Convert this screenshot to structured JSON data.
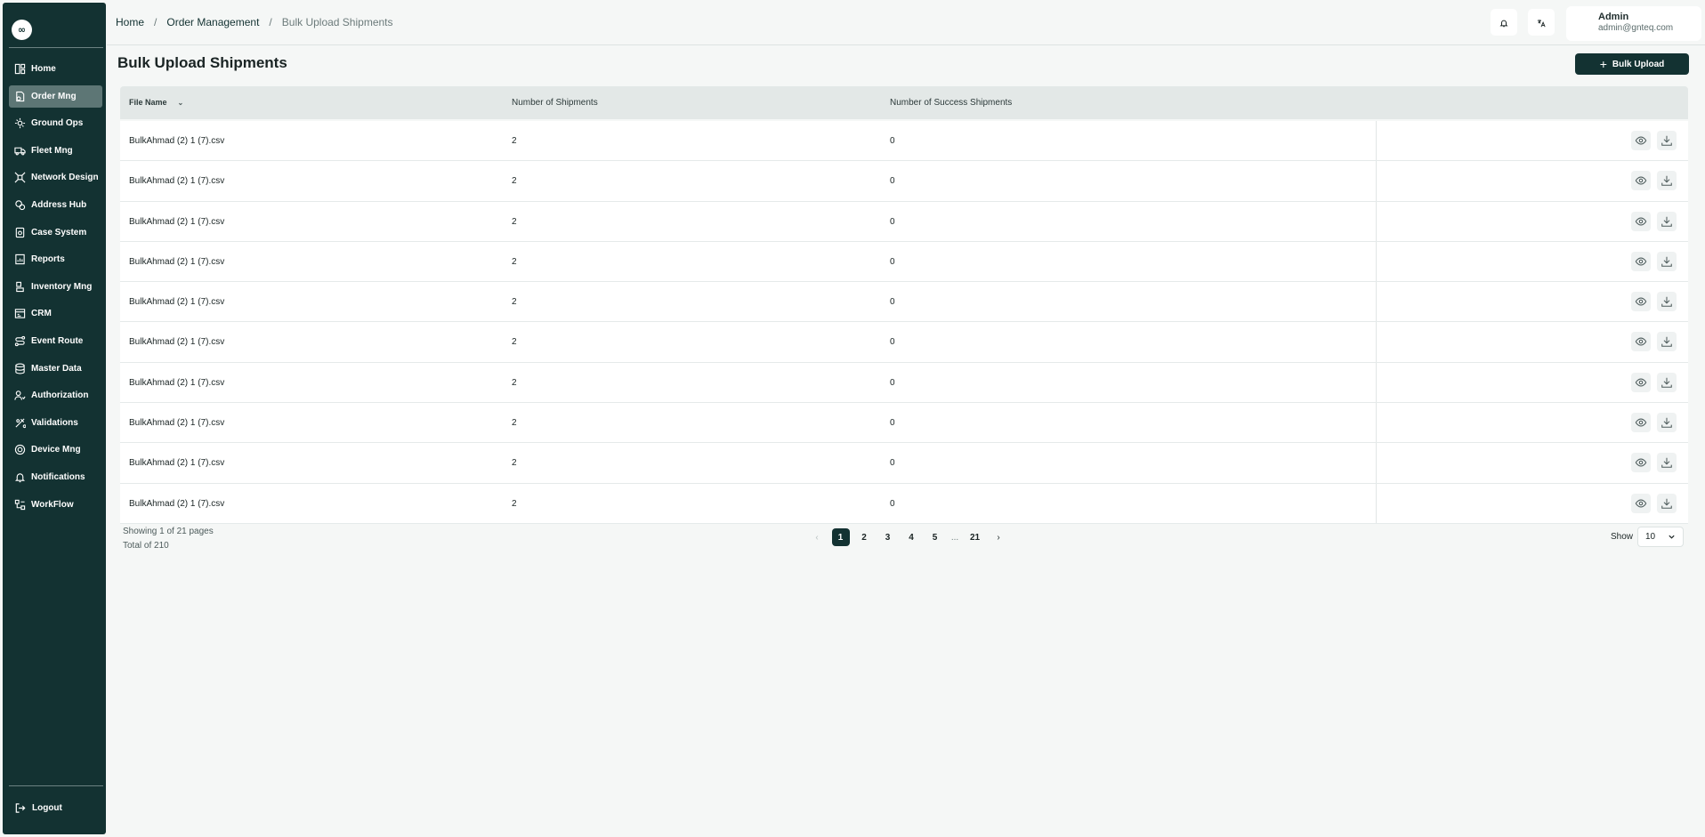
{
  "app": {
    "logo_text": "∞"
  },
  "sidebar": {
    "items": [
      {
        "label": "Home",
        "icon": "home-icon",
        "active": false
      },
      {
        "label": "Order Mng",
        "icon": "order-icon",
        "active": true
      },
      {
        "label": "Ground Ops",
        "icon": "ground-ops-icon",
        "active": false
      },
      {
        "label": "Fleet Mng",
        "icon": "truck-icon",
        "active": false
      },
      {
        "label": "Network Design",
        "icon": "network-icon",
        "active": false
      },
      {
        "label": "Address Hub",
        "icon": "address-icon",
        "active": false
      },
      {
        "label": "Case System",
        "icon": "case-icon",
        "active": false
      },
      {
        "label": "Reports",
        "icon": "reports-icon",
        "active": false
      },
      {
        "label": "Inventory Mng",
        "icon": "inventory-icon",
        "active": false
      },
      {
        "label": "CRM",
        "icon": "crm-icon",
        "active": false
      },
      {
        "label": "Event Route",
        "icon": "route-icon",
        "active": false
      },
      {
        "label": "Master Data",
        "icon": "database-icon",
        "active": false
      },
      {
        "label": "Authorization",
        "icon": "users-icon",
        "active": false
      },
      {
        "label": "Validations",
        "icon": "validations-icon",
        "active": false
      },
      {
        "label": "Device Mng",
        "icon": "device-icon",
        "active": false
      },
      {
        "label": "Notifications",
        "icon": "bell-icon",
        "active": false
      },
      {
        "label": "WorkFlow",
        "icon": "workflow-icon",
        "active": false
      }
    ],
    "logout_label": "Logout"
  },
  "header": {
    "breadcrumb": {
      "home": "Home",
      "section": "Order Management",
      "current": "Bulk Upload Shipments",
      "separator": "/"
    },
    "user": {
      "name": "Admin",
      "email": "admin@gnteq.com"
    }
  },
  "page": {
    "title": "Bulk Upload Shipments",
    "bulk_upload_label": "Bulk Upload"
  },
  "table": {
    "columns": {
      "file_name": "File Name",
      "count": "Number of Shipments",
      "success": "Number of Success Shipments"
    },
    "rows": [
      {
        "file": "BulkAhmad (2) 1 (7).csv",
        "count": "2",
        "success": "0"
      },
      {
        "file": "BulkAhmad (2) 1 (7).csv",
        "count": "2",
        "success": "0"
      },
      {
        "file": "BulkAhmad (2) 1 (7).csv",
        "count": "2",
        "success": "0"
      },
      {
        "file": "BulkAhmad (2) 1 (7).csv",
        "count": "2",
        "success": "0"
      },
      {
        "file": "BulkAhmad (2) 1 (7).csv",
        "count": "2",
        "success": "0"
      },
      {
        "file": "BulkAhmad (2) 1 (7).csv",
        "count": "2",
        "success": "0"
      },
      {
        "file": "BulkAhmad (2) 1 (7).csv",
        "count": "2",
        "success": "0"
      },
      {
        "file": "BulkAhmad (2) 1 (7).csv",
        "count": "2",
        "success": "0"
      },
      {
        "file": "BulkAhmad (2) 1 (7).csv",
        "count": "2",
        "success": "0"
      },
      {
        "file": "BulkAhmad (2) 1 (7).csv",
        "count": "2",
        "success": "0"
      }
    ]
  },
  "pagination": {
    "showing": "Showing 1 of 21 pages",
    "total": "Total of 210",
    "prev": "‹",
    "next": "›",
    "pages": [
      "1",
      "2",
      "3",
      "4",
      "5",
      "...",
      "21"
    ],
    "current": "1",
    "show_label": "Show",
    "page_size": "10"
  },
  "colors": {
    "sidebar": "#133232",
    "accent": "#133232",
    "active_nav": "#5d7675"
  }
}
